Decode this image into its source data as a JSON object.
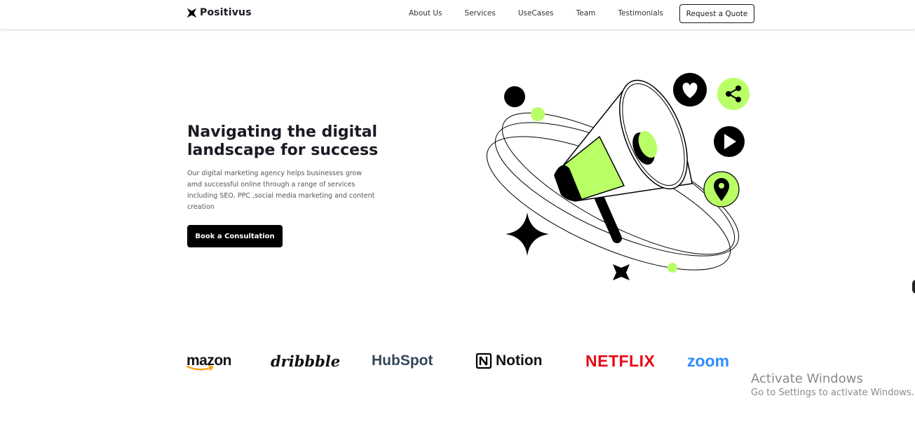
{
  "nav": {
    "brand": "Positivus",
    "links": [
      "About Us",
      "Services",
      "UseCases",
      "Team",
      "Testimonials"
    ],
    "cta": "Request a Quote"
  },
  "hero": {
    "title": "Navigating the digital landscape for success",
    "description": "Our digital marketing agency helps businesses grow amd successful online through a range of services including SEO, PPC ,social media marketing and content creation",
    "button": "Book a Consultation"
  },
  "logos": {
    "amazon": "mazon",
    "dribbble": "dribbble",
    "hubspot": "HubSpot",
    "notion": "Notion",
    "netflix": "NETFLIX",
    "zoom": "zoom"
  },
  "watermark": {
    "title": "Activate Windows",
    "subtitle": "Go to Settings to activate Windows."
  },
  "colors": {
    "accent": "#b9ff66",
    "dark": "#191a23"
  }
}
